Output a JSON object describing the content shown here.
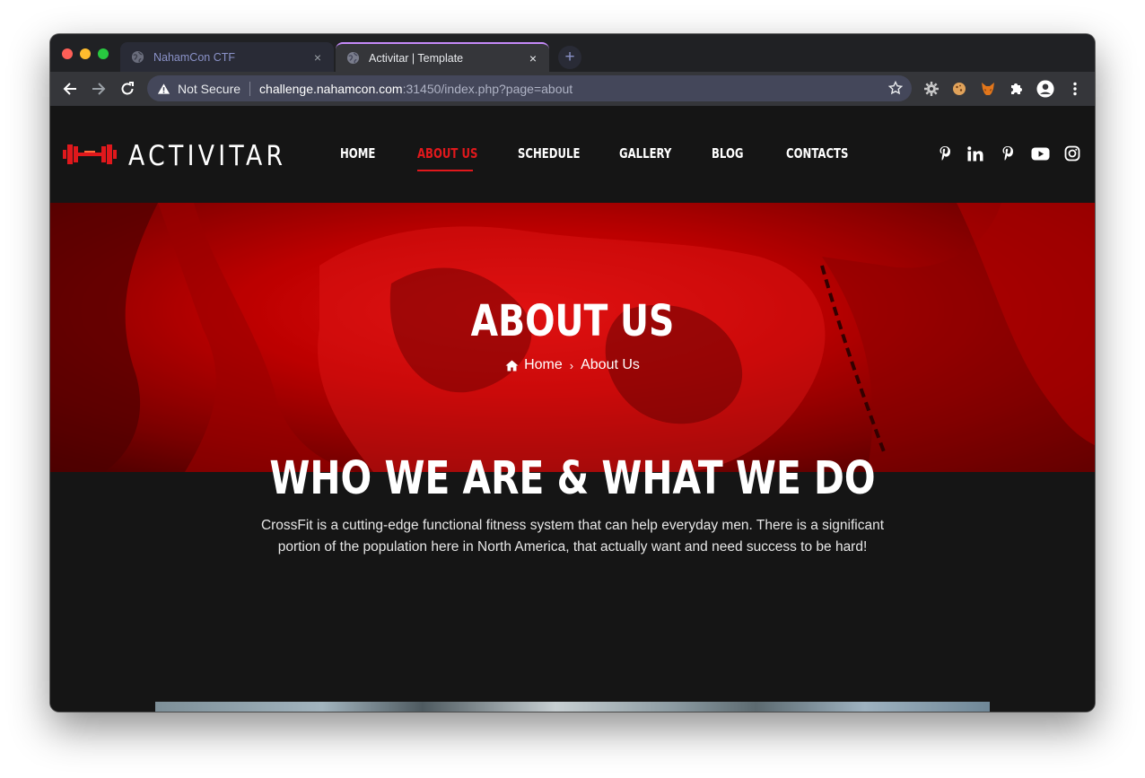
{
  "browser": {
    "tabs": [
      {
        "title": "NahamCon CTF",
        "close": "×",
        "active": false
      },
      {
        "title": "Activitar | Template",
        "close": "×",
        "active": true
      }
    ],
    "new_tab": "+",
    "security_label": "Not Secure",
    "url_host": "challenge.nahamcon.com",
    "url_path": ":31450/index.php?page=about",
    "icons": [
      "back-icon",
      "forward-icon",
      "reload-icon",
      "warning-icon",
      "star-icon",
      "gear-extension-icon",
      "cookie-extension-icon",
      "fox-extension-icon",
      "puzzle-icon",
      "profile-icon",
      "menu-dots-icon"
    ]
  },
  "site": {
    "logo_text": "ACTIVITAR",
    "accent_color": "#e0181c",
    "nav": [
      {
        "label": "Home",
        "active": false
      },
      {
        "label": "About Us",
        "active": true
      },
      {
        "label": "Schedule",
        "active": false
      },
      {
        "label": "Gallery",
        "active": false
      },
      {
        "label": "Blog",
        "active": false
      },
      {
        "label": "Contacts",
        "active": false
      }
    ],
    "social_icons": [
      "pinterest-icon",
      "linkedin-icon",
      "pinterest-icon",
      "youtube-icon",
      "instagram-icon"
    ],
    "hero": {
      "title": "ABOUT US",
      "breadcrumb_home": "Home",
      "breadcrumb_sep": "›",
      "breadcrumb_current": "About Us"
    },
    "section": {
      "title": "WHO WE ARE & WHAT WE DO",
      "text": "CrossFit is a cutting-edge functional fitness system that can help everyday men. There is a significant portion of the population here in North America, that actually want and need success to be hard!"
    }
  }
}
